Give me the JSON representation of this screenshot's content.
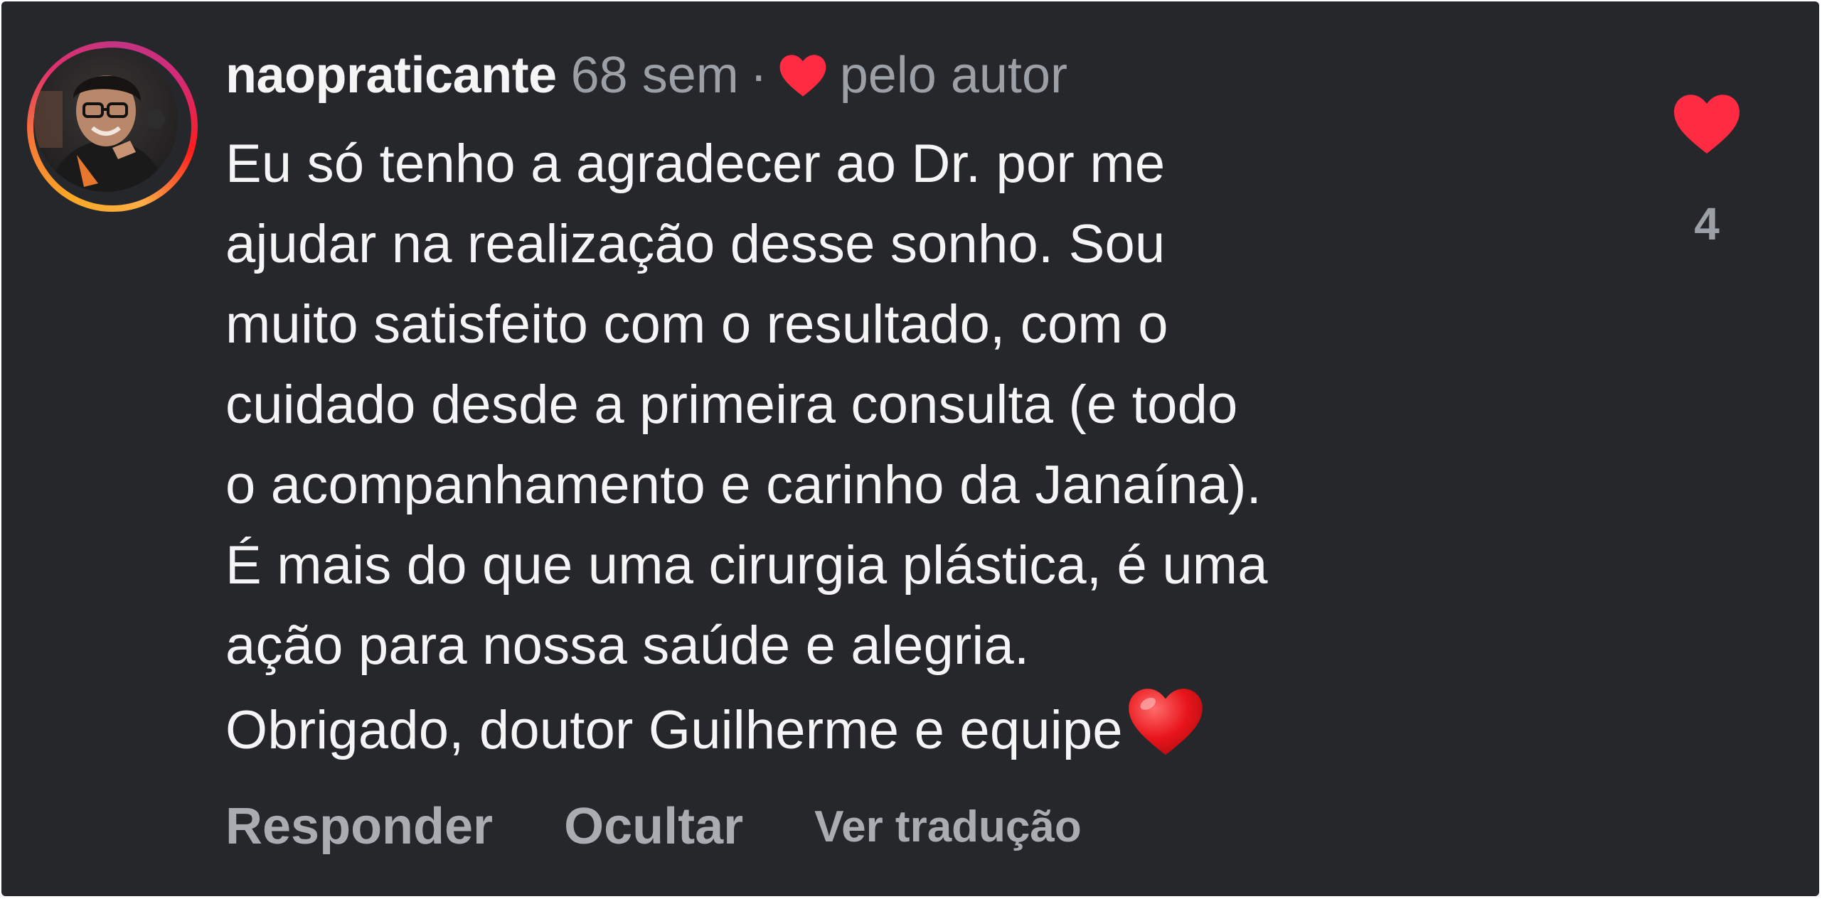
{
  "comment": {
    "username": "naopraticante",
    "time": "68 sem",
    "separator": "·",
    "liked_by_author_label": "pelo autor",
    "text_lines": [
      "Eu só tenho a agradecer ao Dr. por me",
      "ajudar na realização desse sonho. Sou",
      "muito satisfeito com o resultado, com o",
      "cuidado desde a primeira consulta (e todo",
      "o acompanhamento e carinho da Janaína).",
      "É mais do que uma cirurgia plástica, é uma",
      "ação para nossa saúde e alegria.",
      "Obrigado, doutor Guilherme e equipe"
    ],
    "trailing_emoji": "red-heart-emoji",
    "like_count": "4"
  },
  "actions": {
    "reply_label": "Responder",
    "hide_label": "Ocultar",
    "translate_label": "Ver tradução"
  },
  "icons": {
    "author_heart": "heart-icon",
    "like": "heart-icon"
  },
  "colors": {
    "background": "#25272b",
    "text_primary": "#f5f5f5",
    "text_secondary": "#9aa0a6",
    "heart_red": "#ff2b43",
    "story_ring_start": "#f9a825",
    "story_ring_end": "#c13584"
  }
}
